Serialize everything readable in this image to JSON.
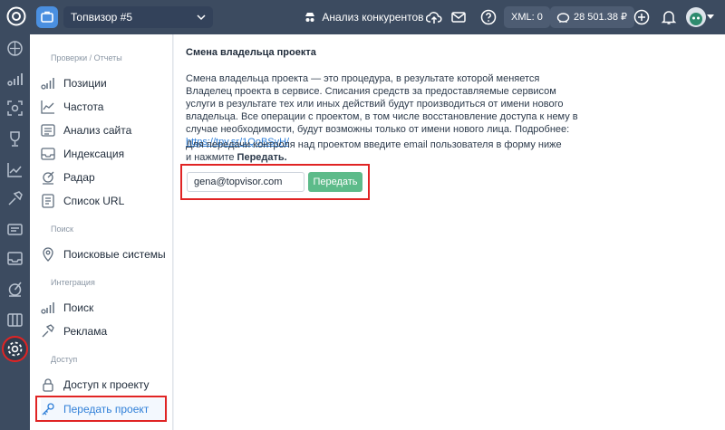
{
  "topbar": {
    "project_name": "Топвизор #5",
    "competitor_label": "Анализ конкурентов",
    "xml_label": "XML: 0",
    "balance": "28 501.38 ₽"
  },
  "sidebar": {
    "sections": [
      {
        "title": "Проверки / Отчеты",
        "items": [
          "Позиции",
          "Частота",
          "Анализ сайта",
          "Индексация",
          "Радар",
          "Список URL"
        ]
      },
      {
        "title": "Поиск",
        "items": [
          "Поисковые системы"
        ]
      },
      {
        "title": "Интеграция",
        "items": [
          "Поиск",
          "Реклама"
        ]
      },
      {
        "title": "Доступ",
        "items": [
          "Доступ к проекту",
          "Передать проект"
        ]
      }
    ],
    "active_item": "Передать проект"
  },
  "content": {
    "heading": "Смена владельца проекта",
    "description": "Смена владельца проекта — это процедура, в результате которой меняется Владелец проекта в сервисе. Списания средств за предоставляемые сервисом услуги в результате тех или иных действий будут производиться от имени нового владельца. Все операции с проектом, в том числе восстановление доступа к нему в случае необходимости, будут возможны только от имени нового лица. Подробнее: ",
    "link": "https://tpv.sr/1QoBSvH/",
    "instruction_line1": "Для передачи контроля над проектом введите email пользователя в форму ниже",
    "instruction_line2": "и нажмите ",
    "instruction_bold": "Передать.",
    "email_value": "gena@topvisor.com",
    "submit_label": "Передать"
  },
  "colors": {
    "topbar": "#3c4b60",
    "accent": "#2f7fd8",
    "button": "#5dbb8a",
    "highlight": "#e02424"
  }
}
